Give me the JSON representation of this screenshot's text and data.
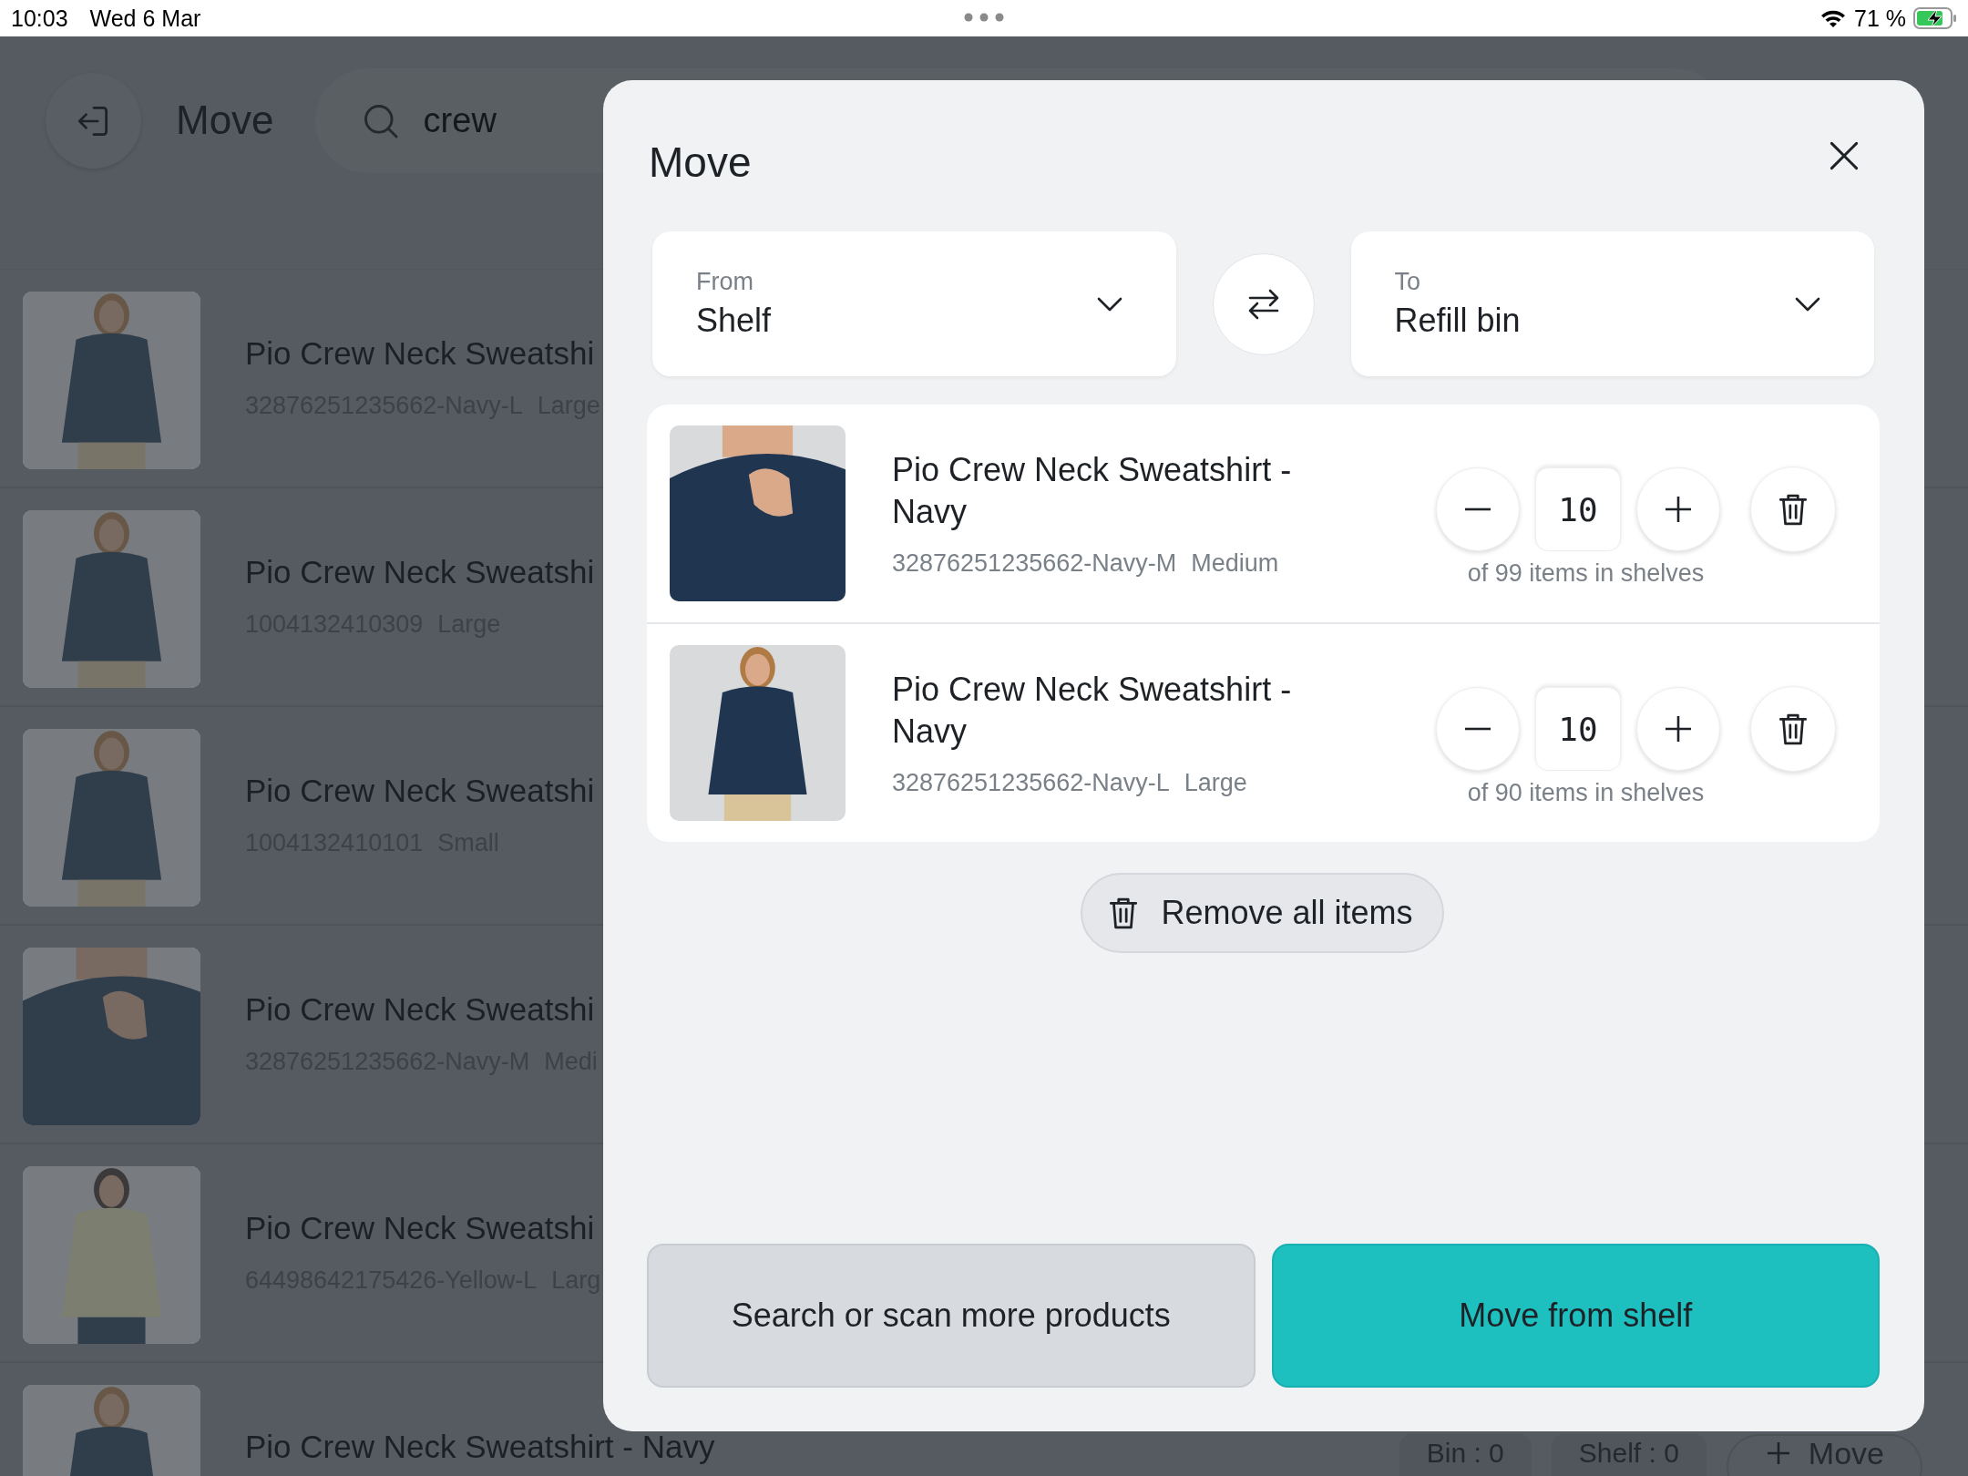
{
  "status_bar": {
    "time": "10:03",
    "date": "Wed 6 Mar",
    "battery": "71 %"
  },
  "header": {
    "title": "Move",
    "search": {
      "value": "crew"
    }
  },
  "list": [
    {
      "title": "Pio Crew Neck Sweatshi",
      "sku": "32876251235662-Navy-L",
      "size": "Large"
    },
    {
      "title": "Pio Crew Neck Sweatshi",
      "sku": "1004132410309",
      "size": "Large"
    },
    {
      "title": "Pio Crew Neck Sweatshi",
      "sku": "1004132410101",
      "size": "Small"
    },
    {
      "title": "Pio Crew Neck Sweatshi",
      "sku": "32876251235662-Navy-M",
      "size": "Medi"
    },
    {
      "title": "Pio Crew Neck Sweatshi",
      "sku": "64498642175426-Yellow-L",
      "size": "Larg"
    },
    {
      "title": "Pio Crew Neck Sweatshirt - Navy",
      "chips": [
        "Bin : 0",
        "Shelf : 0"
      ],
      "action": "Move"
    }
  ],
  "modal": {
    "title": "Move",
    "from": {
      "label": "From",
      "value": "Shelf"
    },
    "to": {
      "label": "To",
      "value": "Refill bin"
    },
    "items": [
      {
        "name": "Pio Crew Neck Sweatshirt - Navy",
        "sku": "32876251235662-Navy-M",
        "size": "Medium",
        "quantity": "10",
        "stock": "of 99 items in shelves"
      },
      {
        "name": "Pio Crew Neck Sweatshirt - Navy",
        "sku": "32876251235662-Navy-L",
        "size": "Large",
        "quantity": "10",
        "stock": "of 90 items in shelves"
      }
    ],
    "remove_all": "Remove all items",
    "buttons": [
      {
        "label": "Search or scan more products",
        "kind": "secondary"
      },
      {
        "label": "Move from shelf",
        "kind": "primary"
      }
    ]
  }
}
